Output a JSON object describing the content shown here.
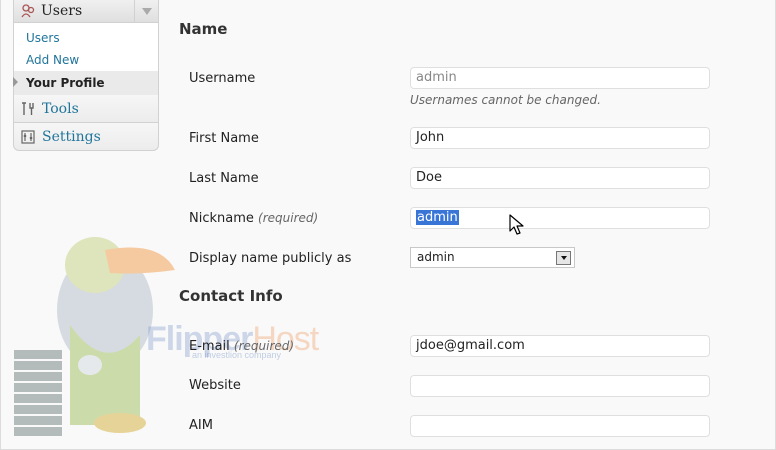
{
  "sidebar": {
    "users_label": "Users",
    "submenu": [
      {
        "label": "Users"
      },
      {
        "label": "Add New"
      },
      {
        "label": "Your Profile"
      }
    ],
    "tools_label": "Tools",
    "settings_label": "Settings"
  },
  "watermark": {
    "brand_a": "Flipper",
    "brand_b": "Host",
    "tagline": "an investlion company"
  },
  "form": {
    "name_heading": "Name",
    "username_label": "Username",
    "username_value": "admin",
    "username_hint": "Usernames cannot be changed.",
    "first_name_label": "First Name",
    "first_name_value": "John",
    "last_name_label": "Last Name",
    "last_name_value": "Doe",
    "nickname_label": "Nickname",
    "required_text": "(required)",
    "nickname_value": "admin",
    "display_label": "Display name publicly as",
    "display_value": "admin",
    "contact_heading": "Contact Info",
    "email_label": "E-mail",
    "email_value": "jdoe@gmail.com",
    "website_label": "Website",
    "website_value": "",
    "aim_label": "AIM",
    "aim_value": ""
  }
}
